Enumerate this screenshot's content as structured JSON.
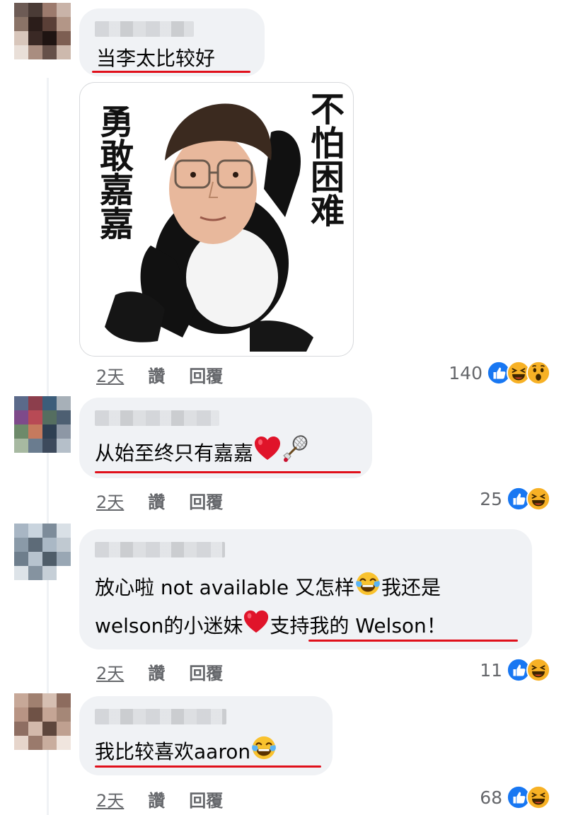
{
  "comments": [
    {
      "text": "当李太比较好",
      "time": "2天",
      "like_label": "讚",
      "reply_label": "回覆",
      "reaction_count": "140",
      "reactions": [
        "like",
        "laugh",
        "wow"
      ],
      "sticker": {
        "left_text": "勇敢嘉嘉",
        "right_text": "不怕困难"
      }
    },
    {
      "text": "从始至终只有嘉嘉",
      "time": "2天",
      "like_label": "讚",
      "reply_label": "回覆",
      "reaction_count": "25",
      "reactions": [
        "like",
        "laugh"
      ],
      "trailing_emojis": [
        "heart",
        "badminton"
      ]
    },
    {
      "line1_text": "放心啦 not available 又怎样",
      "line1_after_emoji": "我还是",
      "line2_text": "welson的小迷妹",
      "line2_after_emoji": "支持我的 Welson！",
      "time": "2天",
      "like_label": "讚",
      "reply_label": "回覆",
      "reaction_count": "11",
      "reactions": [
        "like",
        "laugh"
      ]
    },
    {
      "text": "我比较喜欢aaron",
      "time": "2天",
      "like_label": "讚",
      "reply_label": "回覆",
      "reaction_count": "68",
      "reactions": [
        "like",
        "laugh"
      ],
      "trailing_emojis": [
        "laugh-tears"
      ]
    }
  ],
  "colors": {
    "bubble": "#f0f2f5",
    "underline": "#e0101b",
    "like_blue": "#1877f2",
    "meta_gray": "#65676b"
  }
}
